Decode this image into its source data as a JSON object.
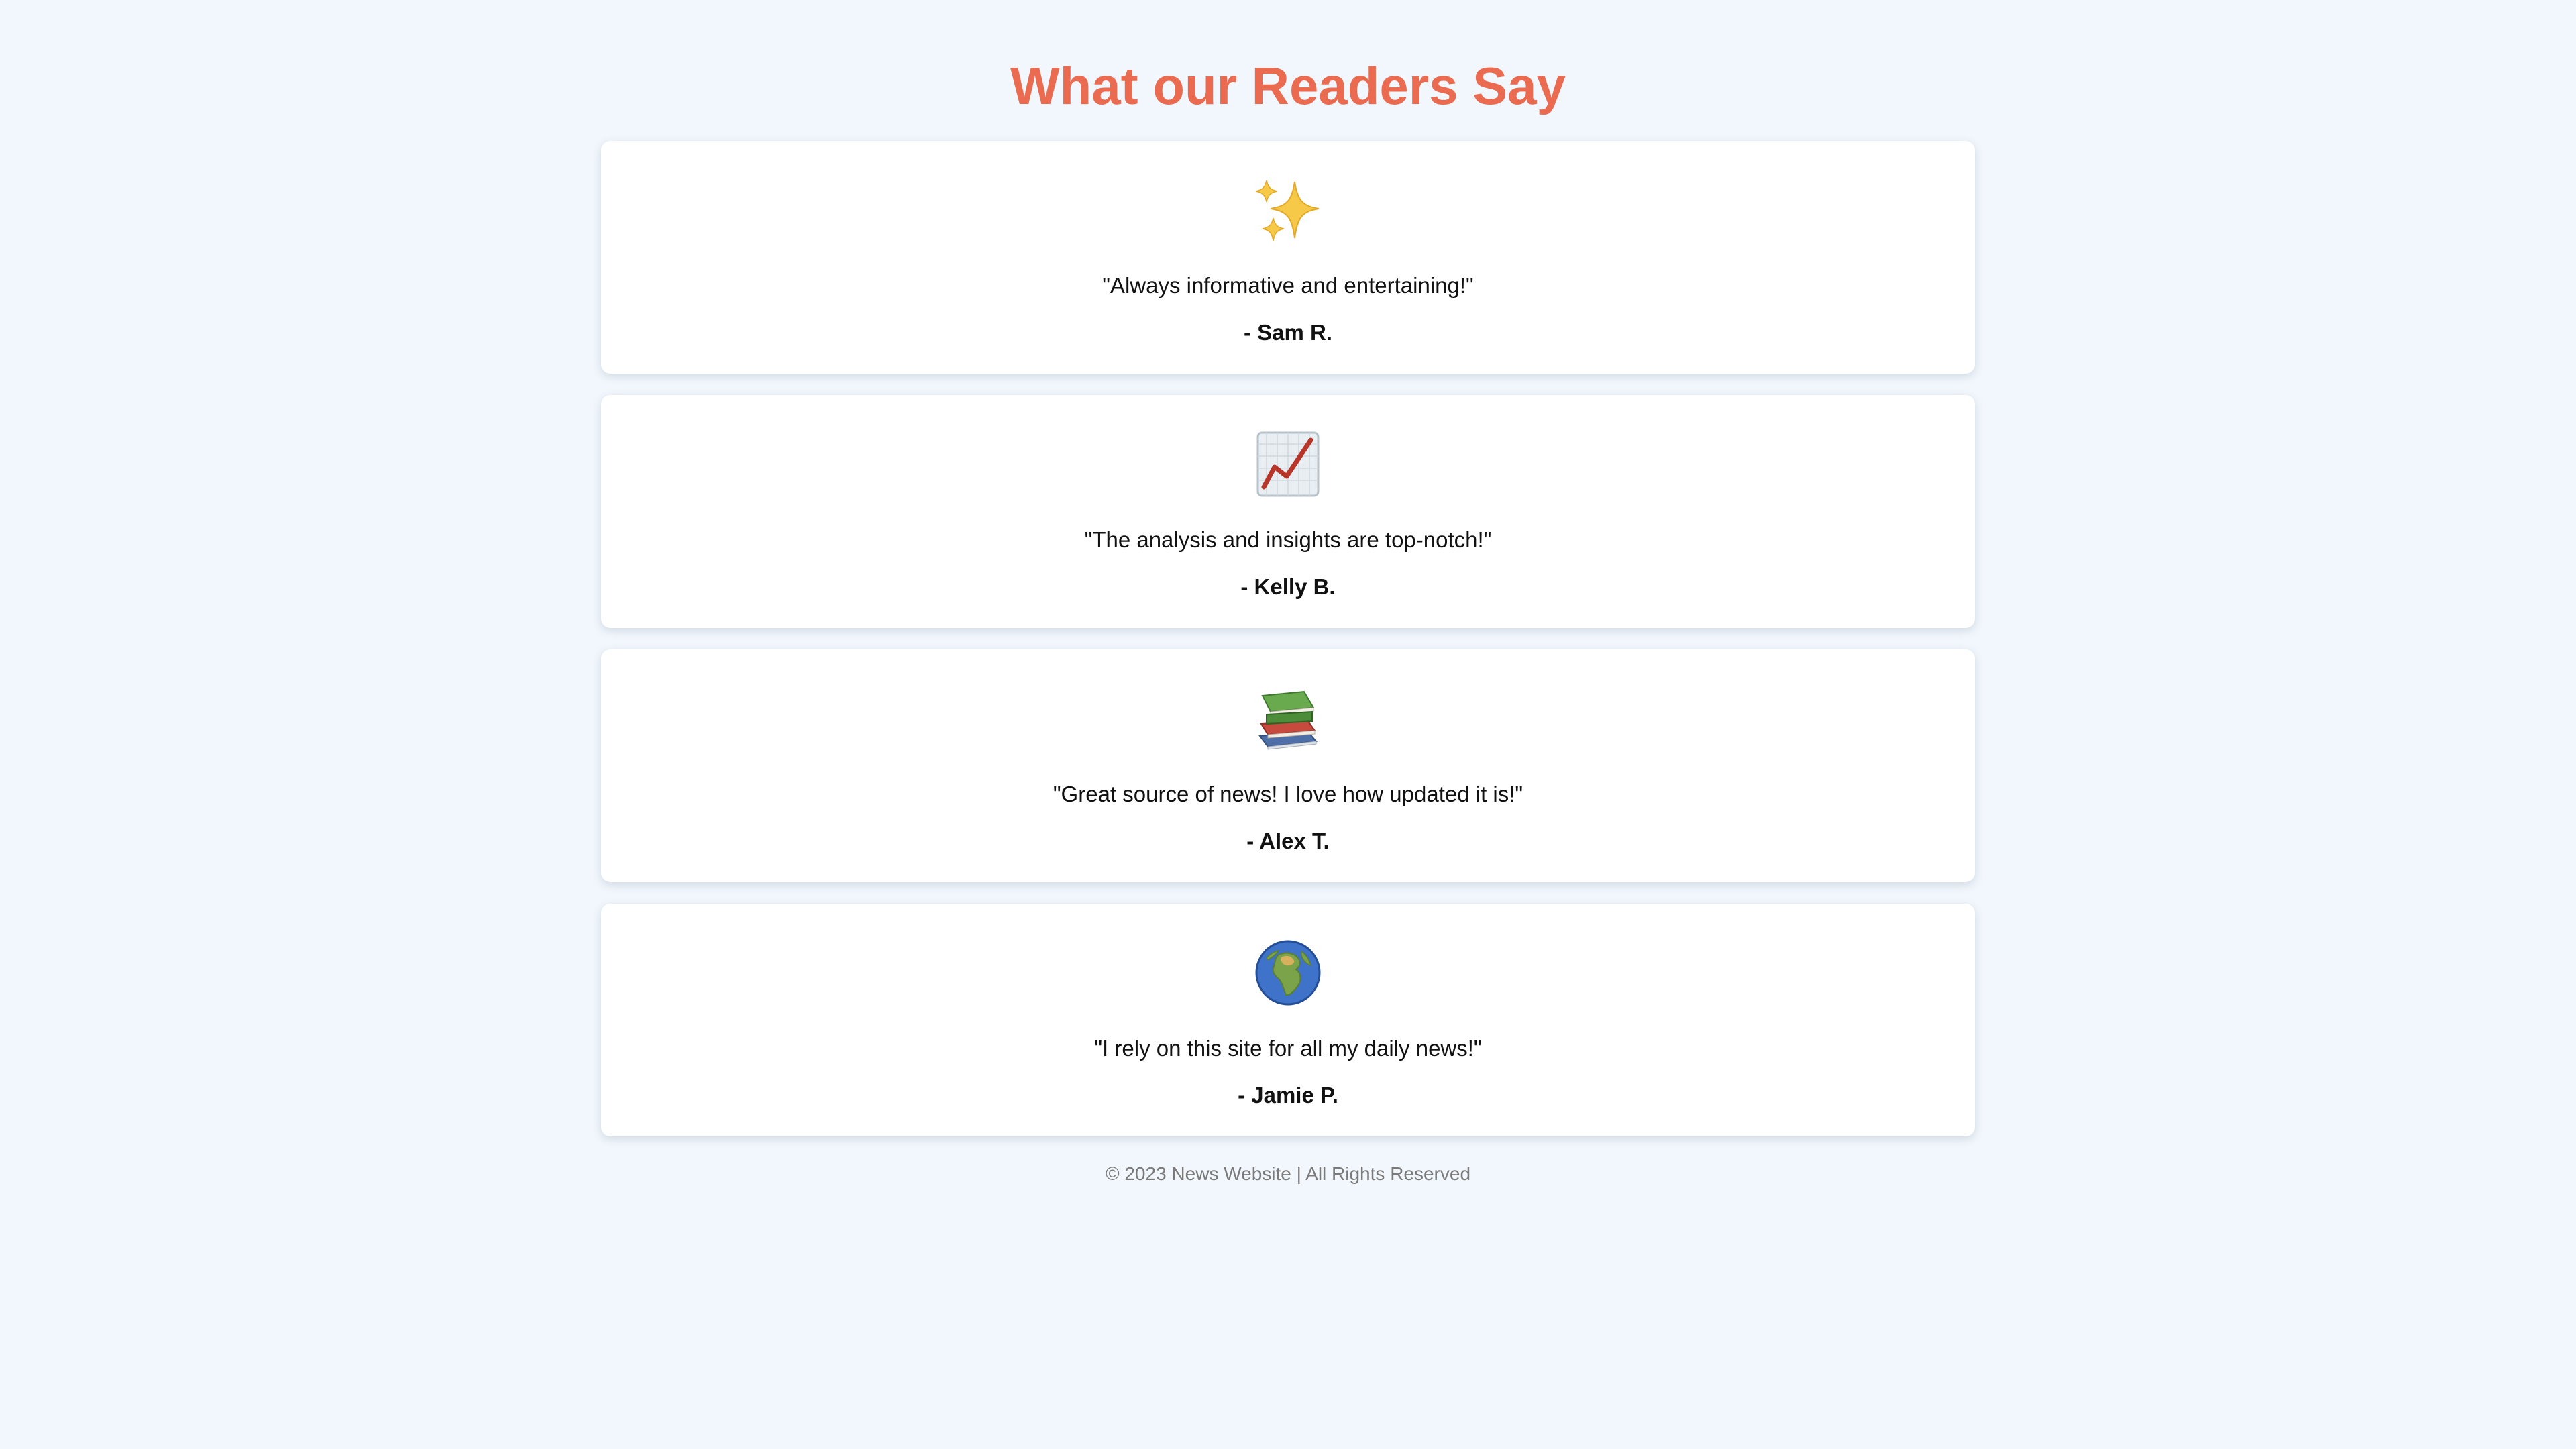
{
  "page": {
    "title": "What our Readers Say",
    "title_color": "#ea6b50",
    "background_color": "#f2f7fd"
  },
  "testimonials": [
    {
      "icon": "sparkles-icon",
      "quote": "\"Always informative and entertaining!\"",
      "author": "- Sam R."
    },
    {
      "icon": "chart-increasing-icon",
      "quote": "\"The analysis and insights are top-notch!\"",
      "author": "- Kelly B."
    },
    {
      "icon": "books-icon",
      "quote": "\"Great source of news! I love how updated it is!\"",
      "author": "- Alex T."
    },
    {
      "icon": "globe-icon",
      "quote": "\"I rely on this site for all my daily news!\"",
      "author": "- Jamie P."
    }
  ],
  "footer": {
    "text": "© 2023 News Website | All Rights Reserved"
  }
}
